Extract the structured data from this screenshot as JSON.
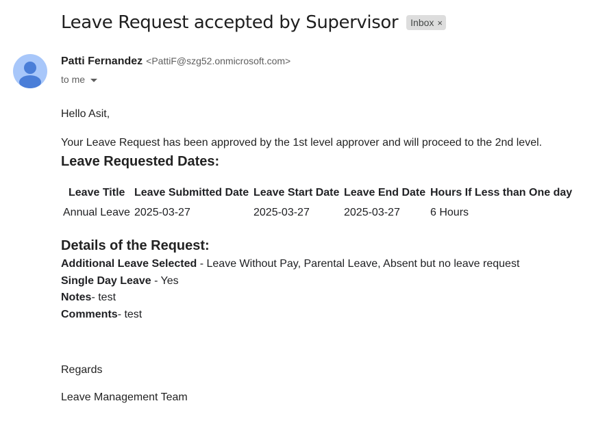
{
  "email": {
    "subject": "Leave Request accepted by Supervisor",
    "label": "Inbox",
    "label_close": "×",
    "sender_name": "Patti Fernandez",
    "sender_email": "<PattiF@szg52.onmicrosoft.com>",
    "recipient": "to me"
  },
  "message": {
    "greeting": "Hello Asit,",
    "intro": "Your Leave Request has been approved by the 1st level approver and will proceed to the 2nd level.",
    "dates_heading": "Leave Requested Dates:",
    "table": {
      "headers": [
        "Leave Title",
        "Leave Submitted Date",
        "Leave Start Date",
        "Leave End Date",
        "Hours If Less than One day"
      ],
      "row": [
        "Annual Leave",
        "2025-03-27",
        "2025-03-27",
        "2025-03-27",
        "6 Hours"
      ]
    },
    "details_heading": "Details of the Request:",
    "details": [
      {
        "label": "Additional Leave Selected",
        "value": " - Leave Without Pay, Parental Leave, Absent but no leave request"
      },
      {
        "label": "Single Day Leave",
        "value": " - Yes"
      },
      {
        "label": "Notes",
        "value": "- test"
      },
      {
        "label": "Comments",
        "value": "- test"
      }
    ],
    "regards": "Regards",
    "signature": "Leave Management Team"
  },
  "colors": {
    "avatar_bg": "#a8c7fa",
    "avatar_fg": "#4a7ed8",
    "label_chip_bg": "#dddddd"
  },
  "icons": {
    "avatar": "person-icon",
    "dropdown": "caret-down-icon"
  }
}
